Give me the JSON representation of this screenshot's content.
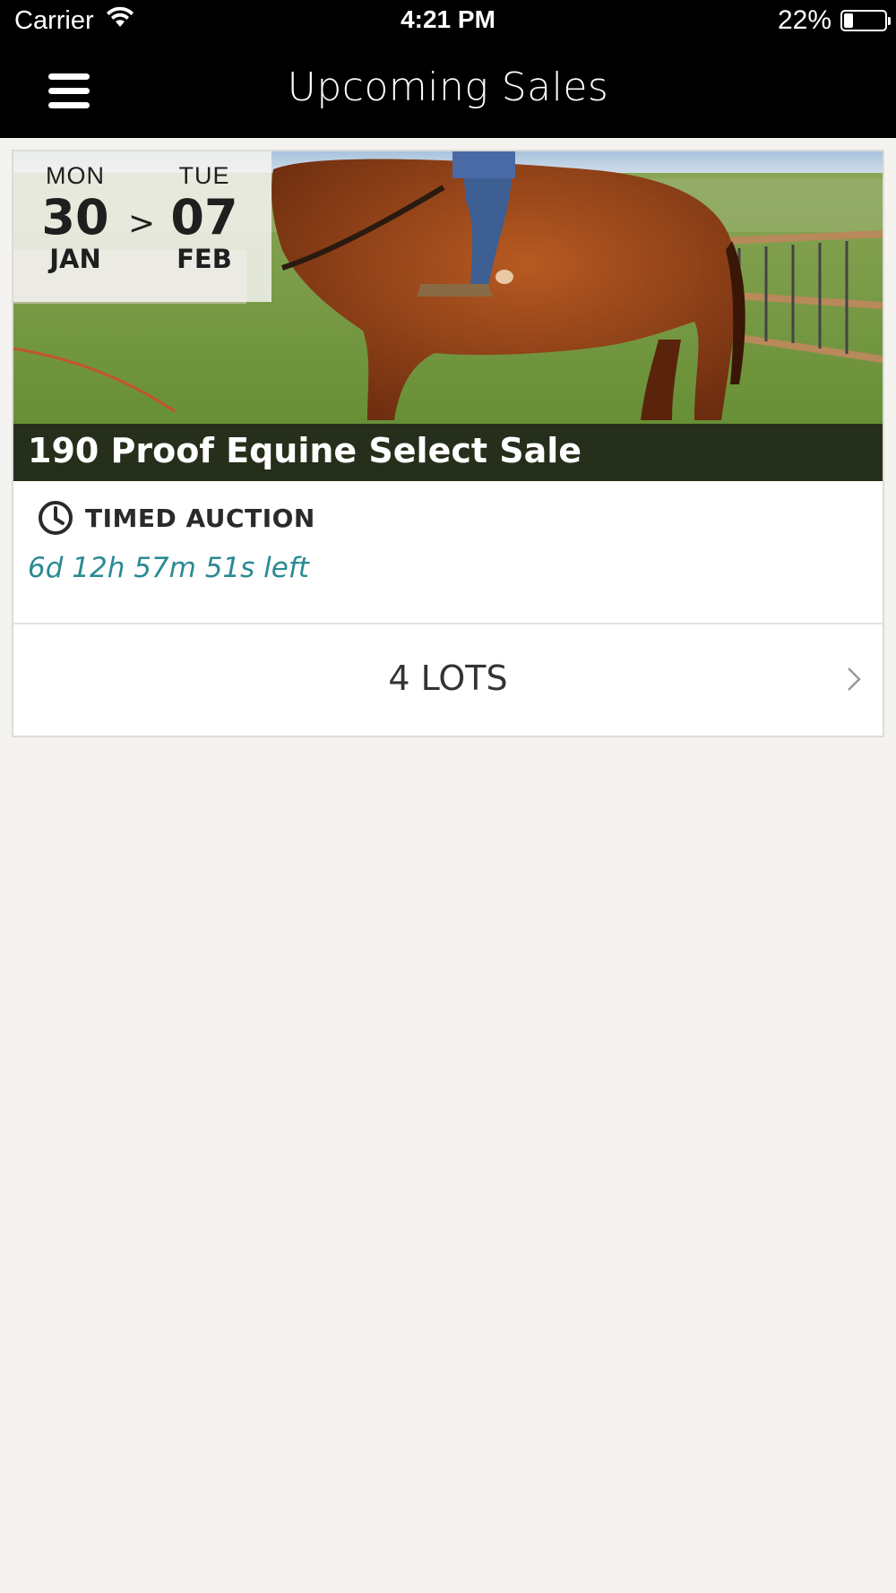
{
  "status_bar": {
    "carrier": "Carrier",
    "time": "4:21 PM",
    "battery_percent": "22%",
    "battery_level": 0.22,
    "icons": [
      "wifi-icon",
      "battery-icon"
    ]
  },
  "nav": {
    "title": "Upcoming Sales",
    "menu_icon": "hamburger-menu-icon"
  },
  "sale": {
    "start": {
      "dow": "MON",
      "day": "30",
      "month": "JAN"
    },
    "arrow": ">",
    "end": {
      "dow": "TUE",
      "day": "07",
      "month": "FEB"
    },
    "title": "190 Proof Equine Select Sale",
    "auction_type": "TIMED AUCTION",
    "auction_icon": "clock-icon",
    "time_left": "6d 12h 57m 51s left",
    "lots_label": "4 LOTS",
    "lots_icon": "chevron-right-icon"
  },
  "colors": {
    "nav_background": "#000000",
    "page_background": "#f4f3f0",
    "time_left_accent": "#2b8a93"
  }
}
